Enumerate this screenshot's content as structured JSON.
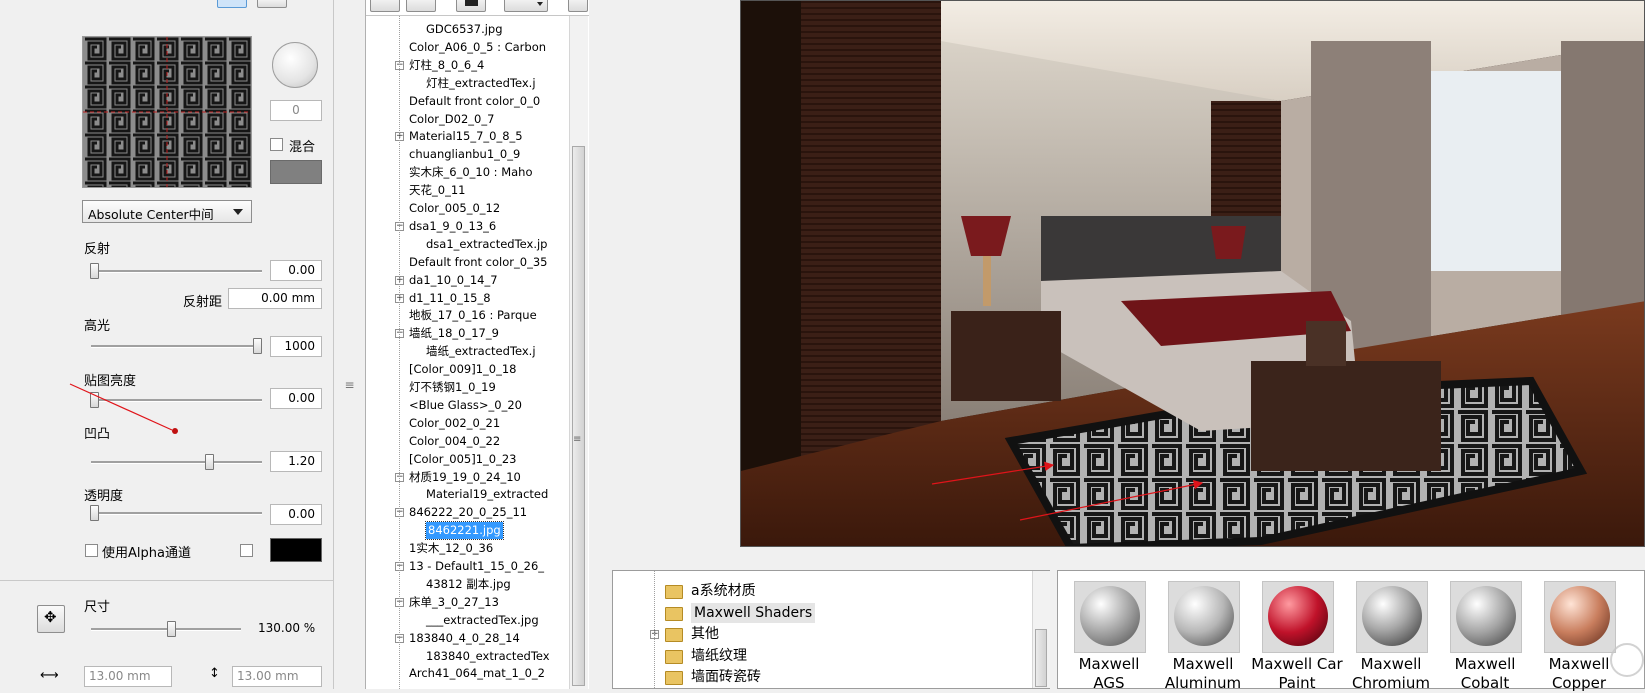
{
  "props": {
    "counter_value": "0",
    "mix_label": "混合",
    "projection_select": "Absolute Center中间",
    "reflection_label": "反射",
    "reflection_value": "0.00",
    "reflection_distance_label": "反射距",
    "reflection_distance_value": "0.00 mm",
    "highlight_label": "高光",
    "highlight_value": "1000",
    "map_brightness_label": "贴图亮度",
    "map_brightness_value": "0.00",
    "bump_label": "凹凸",
    "bump_value": "1.20",
    "transparency_label": "透明度",
    "transparency_value": "0.00",
    "alpha_channel_label": "使用Alpha通道",
    "size_label": "尺寸",
    "size_value": "130.00 %",
    "width_value": "13.00 mm",
    "height_value": "13.00 mm"
  },
  "tree": {
    "items": [
      "GDC6537.jpg",
      "Color_A06_0_5 : Carbon",
      "灯柱_8_0_6_4",
      "灯柱_extractedTex.j",
      "Default front color_0_0",
      "Color_D02_0_7",
      "Material15_7_0_8_5",
      "chuanglianbu1_0_9",
      "实木床_6_0_10 : Maho",
      "天花_0_11",
      "Color_005_0_12",
      "dsa1_9_0_13_6",
      "dsa1_extractedTex.jp",
      "Default front color_0_35",
      "da1_10_0_14_7",
      "d1_11_0_15_8",
      "地板_17_0_16 : Parque",
      "墙纸_18_0_17_9",
      "墙纸_extractedTex.j",
      "[Color_009]1_0_18",
      "灯不锈钢1_0_19",
      "<Blue Glass>_0_20",
      "Color_002_0_21",
      "Color_004_0_22",
      "[Color_005]1_0_23",
      "材质19_19_0_24_10",
      "Material19_extracted",
      "846222_20_0_25_11",
      "8462221.jpg",
      "1实木_12_0_36",
      "13 - Default1_15_0_26_",
      "43812 副本.jpg",
      "床单_3_0_27_13",
      "___extractedTex.jpg",
      "183840_4_0_28_14",
      "183840_extractedTex",
      "Arch41_064_mat_1_0_2"
    ]
  },
  "library": {
    "items": [
      "a系统材质",
      "Maxwell Shaders",
      "其他",
      "墙纸纹理",
      "墙面砖瓷砖"
    ]
  },
  "thumbs": [
    {
      "line1": "Maxwell",
      "line2": "AGS"
    },
    {
      "line1": "Maxwell",
      "line2": "Aluminum"
    },
    {
      "line1": "Maxwell Car",
      "line2": "Paint"
    },
    {
      "line1": "Maxwell",
      "line2": "Chromium"
    },
    {
      "line1": "Maxwell",
      "line2": "Cobalt"
    },
    {
      "line1": "Maxwell",
      "line2": "Copper"
    }
  ],
  "colors": {
    "selection": "#3399ff",
    "annotation_arrow": "#e0141a",
    "mix_swatch": "#808080",
    "alpha_swatch": "#000000"
  }
}
